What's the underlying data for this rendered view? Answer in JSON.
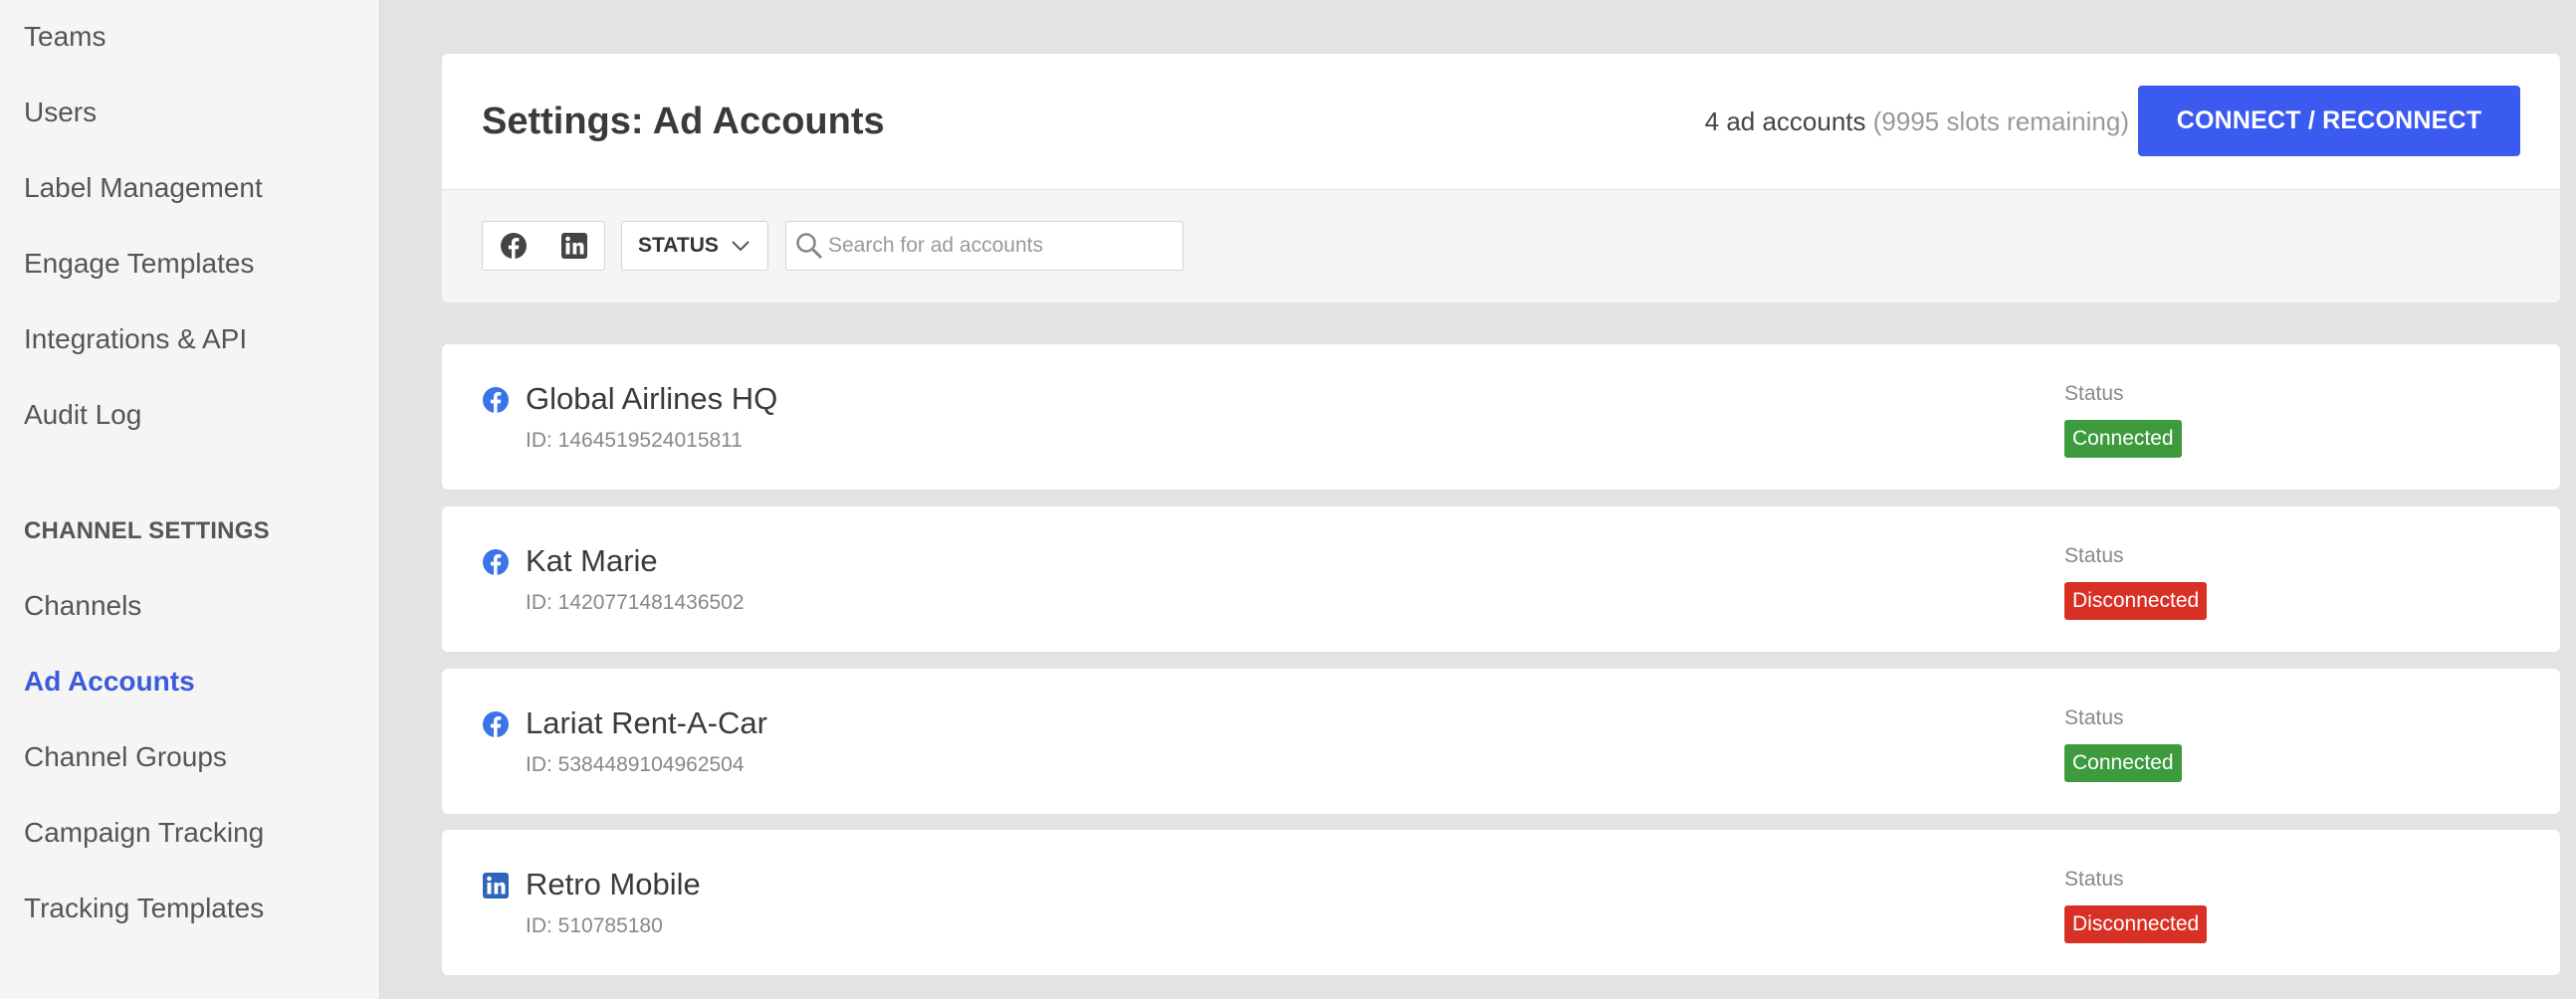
{
  "sidebar": {
    "items_top": [
      "Teams",
      "Users",
      "Label Management",
      "Engage Templates",
      "Integrations & API",
      "Audit Log"
    ],
    "section_title": "CHANNEL SETTINGS",
    "items_channel": [
      "Channels",
      "Ad Accounts",
      "Channel Groups",
      "Campaign Tracking",
      "Tracking Templates"
    ],
    "active_item": "Ad Accounts"
  },
  "header": {
    "title": "Settings: Ad Accounts",
    "count_text": "4 ad accounts",
    "slots_text": "(9995 slots remaining)",
    "connect_button": "CONNECT / RECONNECT"
  },
  "filters": {
    "networks": [
      "facebook-icon",
      "linkedin-icon"
    ],
    "status_dropdown": "STATUS",
    "search_placeholder": "Search for ad accounts",
    "search_value": ""
  },
  "accounts": [
    {
      "name": "Global Airlines HQ",
      "id": "ID: 1464519524015811",
      "network": "facebook",
      "status_label": "Status",
      "status": "Connected"
    },
    {
      "name": "Kat Marie",
      "id": "ID: 1420771481436502",
      "network": "facebook",
      "status_label": "Status",
      "status": "Disconnected"
    },
    {
      "name": "Lariat Rent-A-Car",
      "id": "ID: 5384489104962504",
      "network": "facebook",
      "status_label": "Status",
      "status": "Connected"
    },
    {
      "name": "Retro Mobile",
      "id": "ID: 510785180",
      "network": "linkedin",
      "status_label": "Status",
      "status": "Disconnected"
    }
  ],
  "colors": {
    "accent": "#3b5bf0",
    "active_nav": "#3b5bdb",
    "connected": "#3d9a3d",
    "disconnected": "#d93025",
    "facebook": "#3b73e8",
    "linkedin": "#2d64bc"
  }
}
